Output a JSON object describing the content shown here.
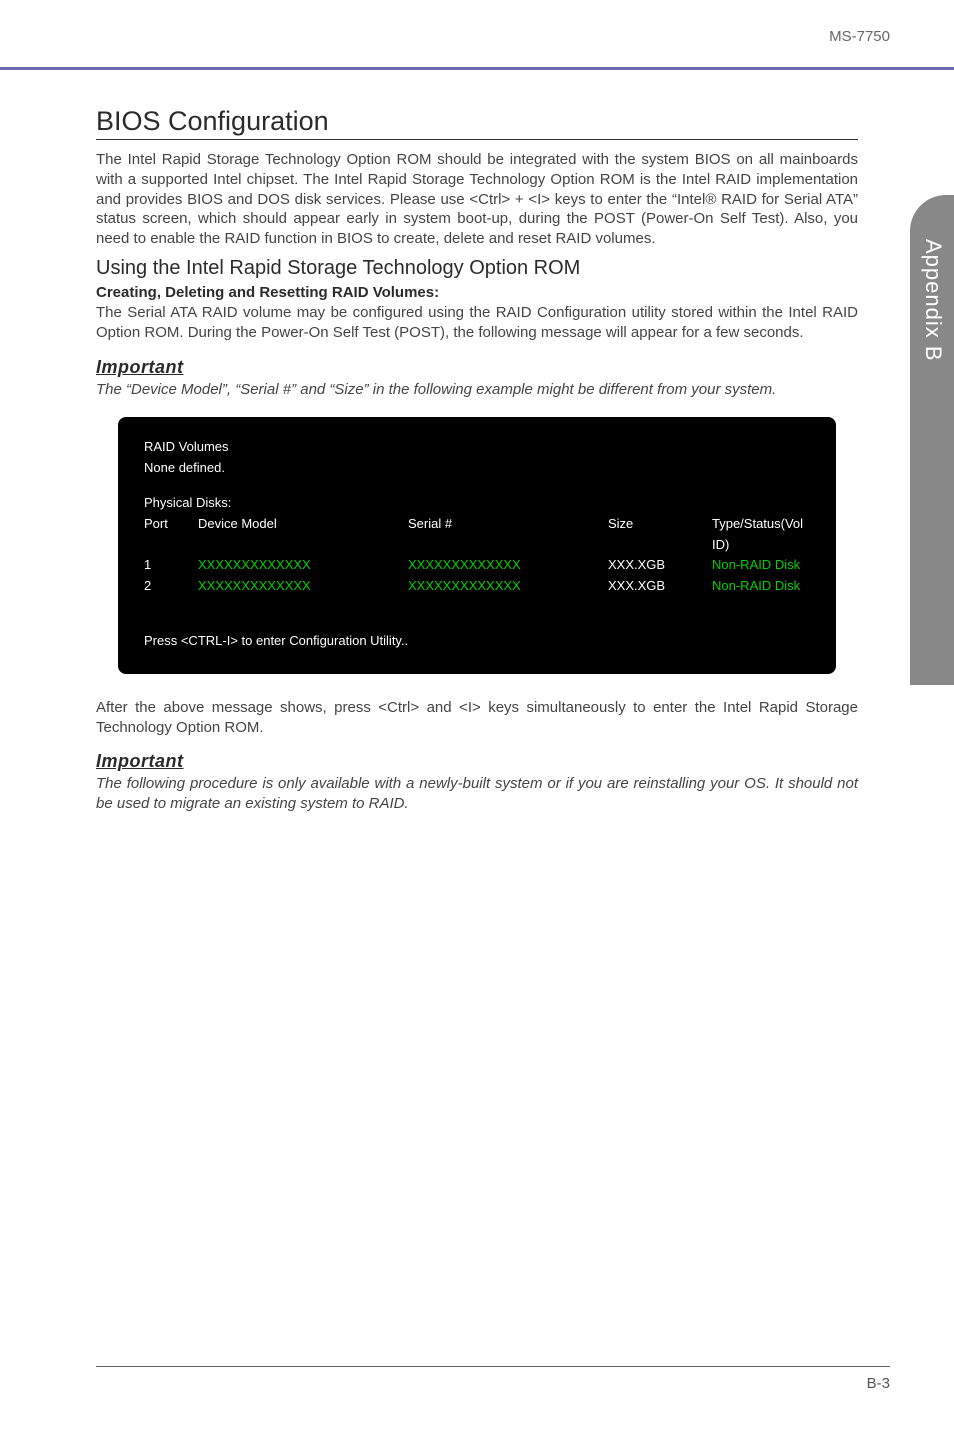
{
  "header": {
    "doc_id": "MS-7750"
  },
  "side_tab": {
    "label": "Appendix B"
  },
  "section": {
    "title": "BIOS Configuration",
    "intro": "The Intel Rapid Storage Technology Option ROM should be integrated with the system BIOS on all mainboards with a supported Intel chipset. The Intel Rapid Storage Technology Option ROM is the Intel RAID implementation and provides BIOS and DOS disk services. Please use <Ctrl> + <I> keys to enter the “Intel® RAID for Serial ATA” status screen, which should  appear early in system boot-up, during the POST (Power-On Self Test). Also, you need to enable the RAID function in BIOS to create, delete and reset RAID volumes.",
    "sub_title": "Using the Intel Rapid Storage Technology Option ROM",
    "sub_bold": "Creating, Deleting and Resetting RAID Volumes:",
    "sub_body": "The Serial ATA RAID volume may be configured using the RAID Configuration utility stored within the Intel RAID Option ROM. During the Power-On Self Test (POST), the following message will appear for a few seconds."
  },
  "important1": {
    "label": "Important",
    "note": "The “Device Model”, “Serial #” and “Size” in the following example might be different from your system."
  },
  "console": {
    "raid_volumes_label": "RAID Volumes",
    "none_defined": "None defined.",
    "physical_disks_label": "Physical Disks:",
    "headers": {
      "port": "Port",
      "model": "Device Model",
      "serial": "Serial #",
      "size": "Size",
      "type": "Type/Status(Vol ID)"
    },
    "rows": [
      {
        "port": "1",
        "model": "XXXXXXXXXXXXX",
        "serial": "XXXXXXXXXXXXX",
        "size": "XXX.XGB",
        "type": "Non-RAID Disk"
      },
      {
        "port": "2",
        "model": "XXXXXXXXXXXXX",
        "serial": "XXXXXXXXXXXXX",
        "size": "XXX.XGB",
        "type": "Non-RAID Disk"
      }
    ],
    "footer_prompt": "Press  <CTRL-I>  to enter Configuration Utility.."
  },
  "after_console": "After the above message shows, press <Ctrl> and <I> keys simultaneously to enter the Intel Rapid Storage Technology Option ROM.",
  "important2": {
    "label": "Important",
    "note": "The following procedure is only available with a newly-built system or if you are reinstalling your OS. It should not be used to migrate an existing system to RAID."
  },
  "footer": {
    "page": "B-3"
  }
}
